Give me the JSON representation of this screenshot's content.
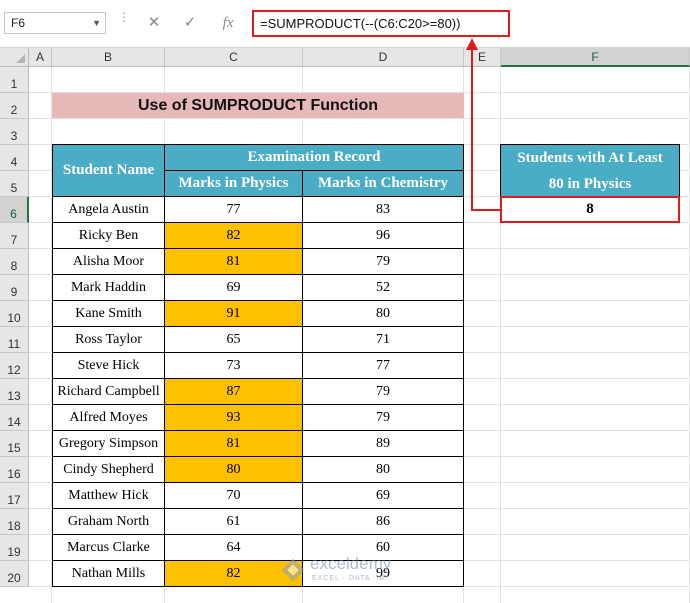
{
  "formula_bar": {
    "name_box": "F6",
    "cancel_symbol": "✕",
    "enter_symbol": "✓",
    "fx_symbol": "fx",
    "formula": "=SUMPRODUCT(--(C6:C20>=80))"
  },
  "columns": [
    "A",
    "B",
    "C",
    "D",
    "E",
    "F"
  ],
  "selected_column": "F",
  "rows": [
    "1",
    "2",
    "3",
    "4",
    "5",
    "6",
    "7",
    "8",
    "9",
    "10",
    "11",
    "12",
    "13",
    "14",
    "15",
    "16",
    "17",
    "18",
    "19",
    "20"
  ],
  "selected_row": "6",
  "title": "Use of SUMPRODUCT Function",
  "table": {
    "header_name": "Student Name",
    "header_group": "Examination Record",
    "header_physics": "Marks in Physics",
    "header_chemistry": "Marks in Chemistry",
    "students": [
      {
        "name": "Angela Austin",
        "physics": "77",
        "chemistry": "83",
        "highlight": false
      },
      {
        "name": "Ricky Ben",
        "physics": "82",
        "chemistry": "96",
        "highlight": true
      },
      {
        "name": "Alisha Moor",
        "physics": "81",
        "chemistry": "79",
        "highlight": true
      },
      {
        "name": "Mark Haddin",
        "physics": "69",
        "chemistry": "52",
        "highlight": false
      },
      {
        "name": "Kane Smith",
        "physics": "91",
        "chemistry": "80",
        "highlight": true
      },
      {
        "name": "Ross Taylor",
        "physics": "65",
        "chemistry": "71",
        "highlight": false
      },
      {
        "name": "Steve Hick",
        "physics": "73",
        "chemistry": "77",
        "highlight": false
      },
      {
        "name": "Richard Campbell",
        "physics": "87",
        "chemistry": "79",
        "highlight": true
      },
      {
        "name": "Alfred Moyes",
        "physics": "93",
        "chemistry": "79",
        "highlight": true
      },
      {
        "name": "Gregory Simpson",
        "physics": "81",
        "chemistry": "89",
        "highlight": true
      },
      {
        "name": "Cindy Shepherd",
        "physics": "80",
        "chemistry": "80",
        "highlight": true
      },
      {
        "name": "Matthew Hick",
        "physics": "70",
        "chemistry": "69",
        "highlight": false
      },
      {
        "name": "Graham North",
        "physics": "61",
        "chemistry": "86",
        "highlight": false
      },
      {
        "name": "Marcus Clarke",
        "physics": "64",
        "chemistry": "60",
        "highlight": false
      },
      {
        "name": "Nathan Mills",
        "physics": "82",
        "chemistry": "99",
        "highlight": true
      }
    ]
  },
  "result": {
    "header_line1": "Students with At Least",
    "header_line2": "80 in Physics",
    "value": "8"
  },
  "watermark": {
    "brand": "exceldemy",
    "tagline": "EXCEL · DATA · BI"
  },
  "colors": {
    "header_fill": "#4bacc6",
    "title_fill": "#e6b8b7",
    "highlight_fill": "#ffc000",
    "callout_red": "#e01b1b"
  }
}
